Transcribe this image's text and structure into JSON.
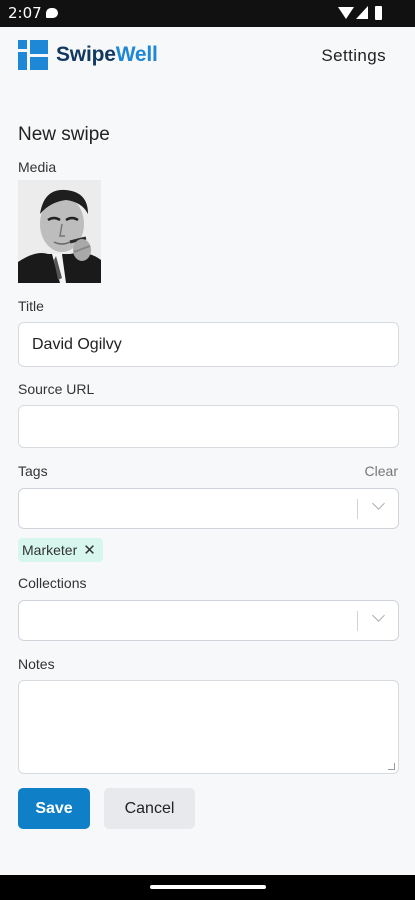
{
  "status_bar": {
    "time": "2:07"
  },
  "header": {
    "brand_prefix": "Swipe",
    "brand_suffix": "Well",
    "settings_label": "Settings"
  },
  "form": {
    "title": "New swipe",
    "media_label": "Media",
    "title_label": "Title",
    "title_value": "David Ogilvy",
    "source_url_label": "Source URL",
    "source_url_value": "",
    "tags_label": "Tags",
    "tags_clear_label": "Clear",
    "tags": [
      {
        "label": "Marketer"
      }
    ],
    "collections_label": "Collections",
    "notes_label": "Notes",
    "notes_value": ""
  },
  "actions": {
    "save_label": "Save",
    "cancel_label": "Cancel"
  },
  "colors": {
    "accent": "#1e88d6",
    "brand_dark": "#12385f",
    "save_button": "#0f7fc7",
    "tag_chip": "#d7f7ee"
  }
}
